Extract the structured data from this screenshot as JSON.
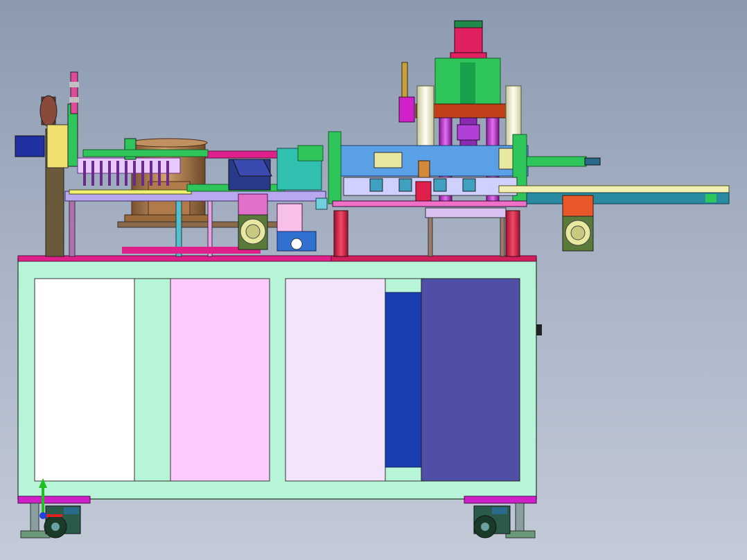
{
  "viewport": {
    "background_top": "#8b9ab0",
    "background_bottom": "#c3cad8"
  },
  "machine": {
    "cabinet_color": "#b8f5d8",
    "top_plate_color": "#e0208a",
    "panel_colors": [
      "#ffffff",
      "#b8f5d8",
      "#fecbfc",
      "#f4e4fb",
      "#1a3db0",
      "#4f4fa6"
    ],
    "accent_magenta": "#d020c8",
    "accent_green": "#2ec55a",
    "accent_blue": "#5aa0e6",
    "bowl_color": "#b8864a",
    "red_posts": "#e0204a",
    "orange_motor": "#e8582a"
  },
  "triad": {
    "x_axis_color": "#e02020",
    "y_axis_color": "#20c020",
    "z_axis_color": "#2040e0"
  }
}
